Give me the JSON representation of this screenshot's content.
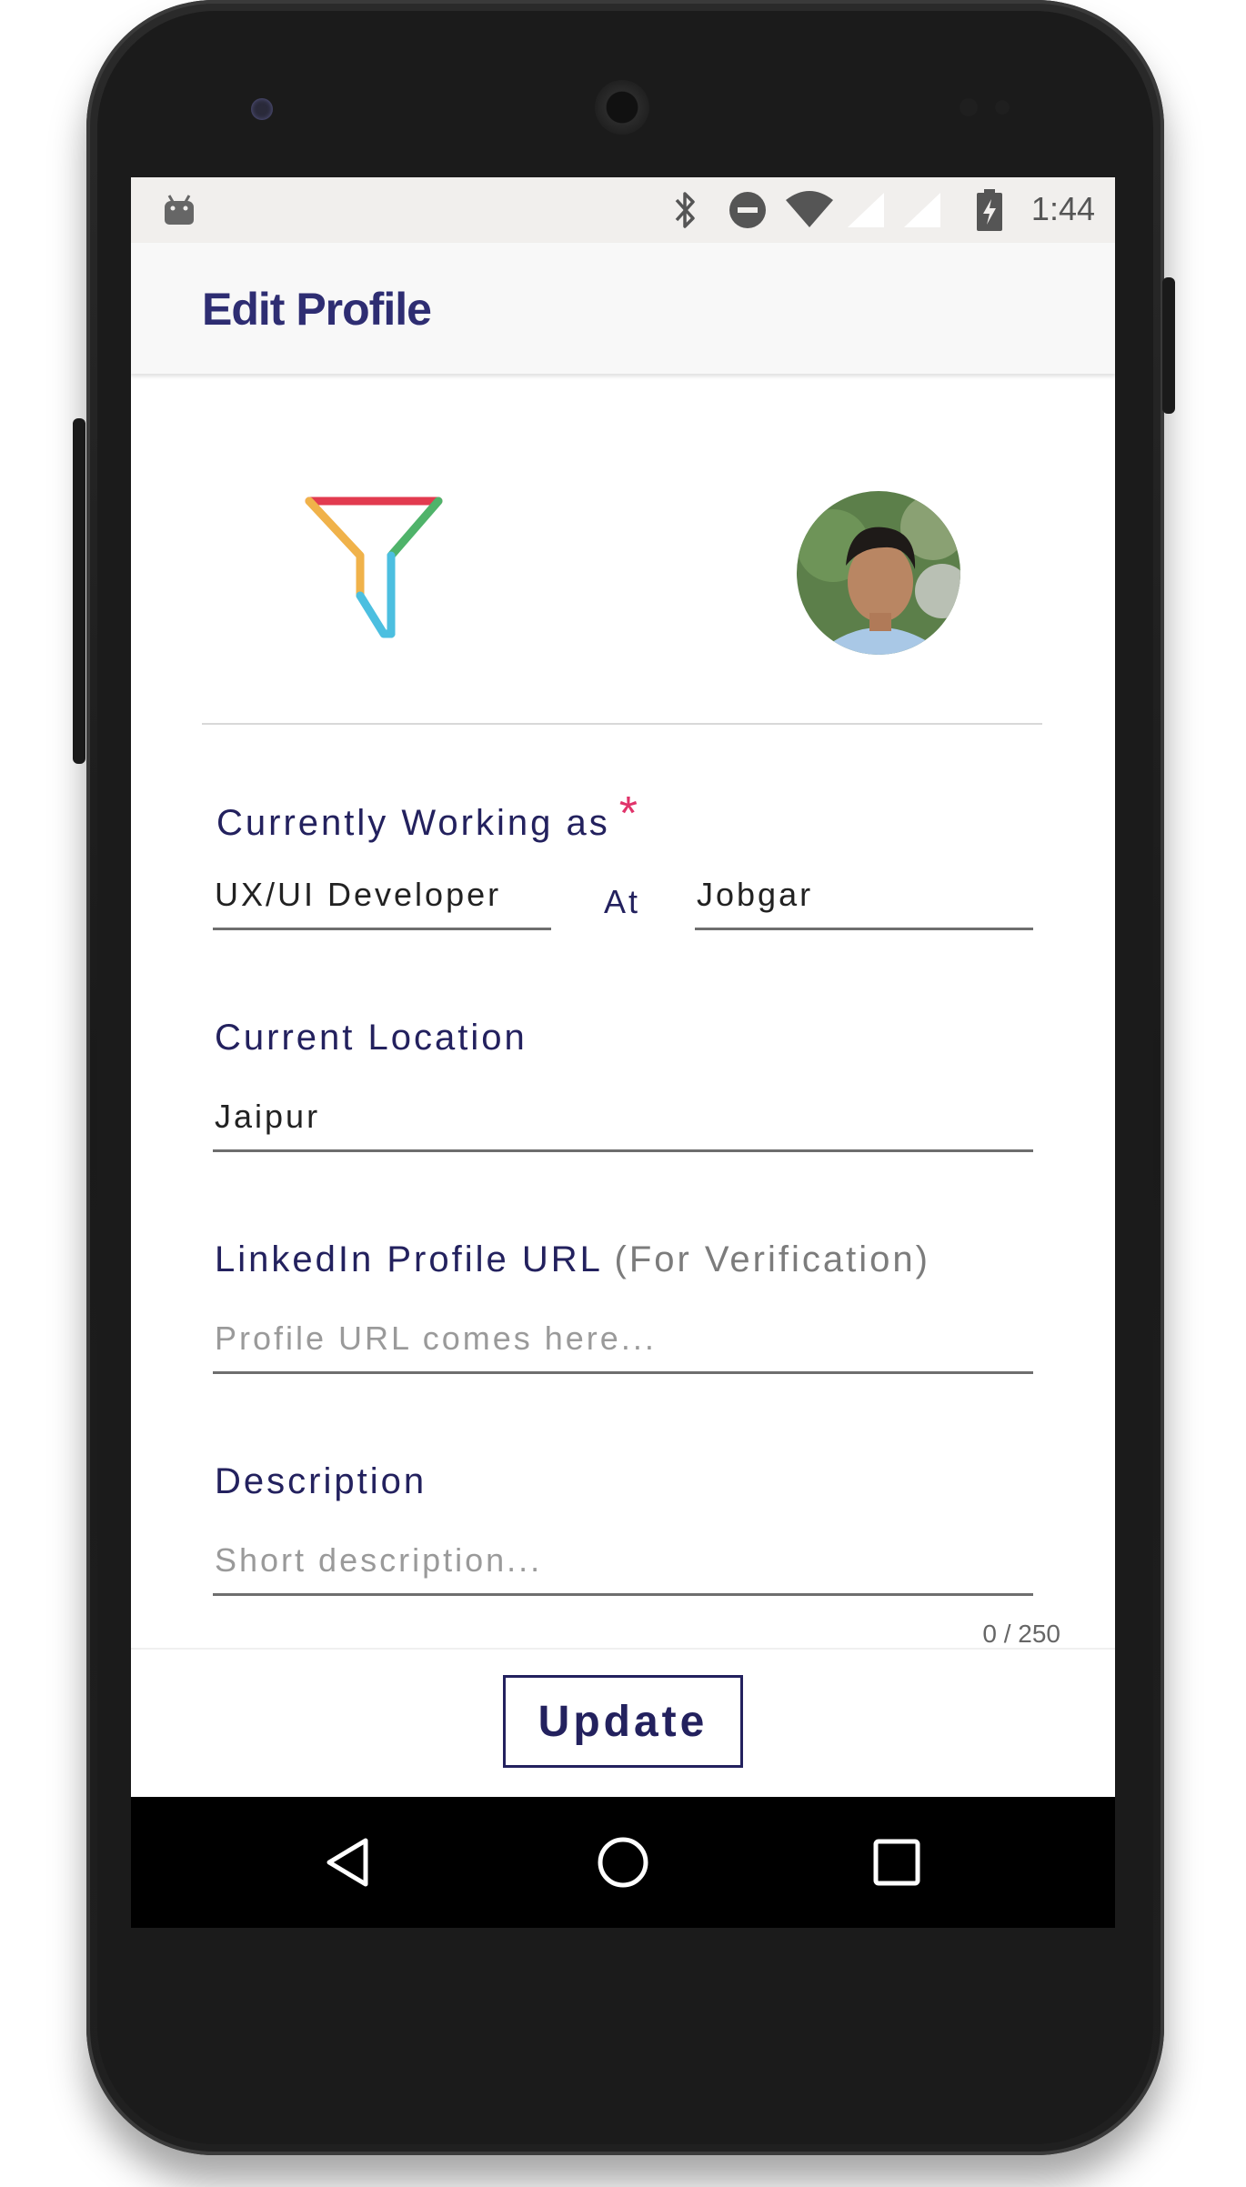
{
  "statusbar": {
    "time": "1:44",
    "icons": [
      "android-debug-icon",
      "bluetooth-icon",
      "do-not-disturb-icon",
      "wifi-icon",
      "signal-icon",
      "signal-icon",
      "battery-charging-icon"
    ]
  },
  "appbar": {
    "title": "Edit Profile"
  },
  "profile": {
    "logo_icon": "funnel-logo-icon",
    "avatar_icon": "user-avatar"
  },
  "form": {
    "working_as": {
      "label": "Currently Working as",
      "required_mark": "*",
      "role_value": "UX/UI Developer",
      "at_label": "At",
      "company_value": "Jobgar"
    },
    "location": {
      "label": "Current Location",
      "value": "Jaipur"
    },
    "linkedin": {
      "label": "LinkedIn Profile URL",
      "label_hint": "(For Verification)",
      "placeholder": "Profile URL comes here..."
    },
    "description": {
      "label": "Description",
      "placeholder": "Short description...",
      "counter": "0 / 250"
    }
  },
  "actions": {
    "update_label": "Update"
  },
  "navbar": {
    "icons": [
      "back-icon",
      "home-icon",
      "recents-icon"
    ]
  },
  "colors": {
    "accent": "#23215e",
    "title": "#2e2d72",
    "required": "#e0336a",
    "logo_red": "#e23b4f",
    "logo_green": "#4fb36a",
    "logo_yellow": "#f0b24a",
    "logo_blue": "#4cbfe0"
  }
}
